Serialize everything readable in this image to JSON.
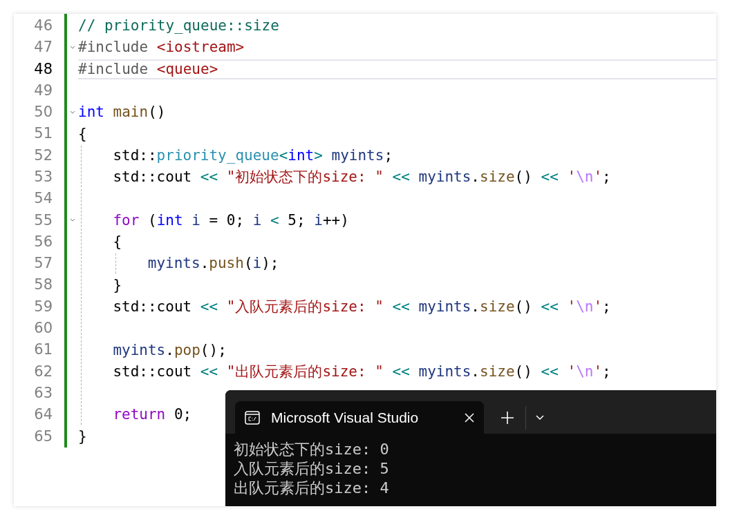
{
  "editor": {
    "lines": [
      {
        "number": "46",
        "current": false,
        "fold": false,
        "segments": [
          {
            "text": "// priority_queue::size",
            "color": "#0e6a5a"
          }
        ]
      },
      {
        "number": "47",
        "current": false,
        "fold": true,
        "segments": [
          {
            "text": "#include ",
            "color": "#5b5b5b"
          },
          {
            "text": "<iostream>",
            "color": "#a31515"
          }
        ]
      },
      {
        "number": "48",
        "current": true,
        "fold": false,
        "segments": [
          {
            "text": "#include ",
            "color": "#5b5b5b"
          },
          {
            "text": "<queue>",
            "color": "#a31515"
          }
        ]
      },
      {
        "number": "49",
        "current": false,
        "fold": false
      },
      {
        "number": "50",
        "current": false,
        "fold": true,
        "segments": [
          {
            "text": "int",
            "color": "#0000ff"
          },
          {
            "text": " main",
            "color": "#74531f"
          },
          {
            "text": "()",
            "color": "#000000"
          }
        ]
      },
      {
        "number": "51",
        "current": false,
        "fold": false,
        "segments": [
          {
            "text": "{",
            "color": "#000000"
          }
        ],
        "children": [
          {
            "number": "52",
            "current": false,
            "fold": false,
            "segments": [
              {
                "text": "std::",
                "color": "#000000"
              },
              {
                "text": "priority_queue",
                "color": "#2b91af"
              },
              {
                "text": "<",
                "color": "#008080"
              },
              {
                "text": "int",
                "color": "#0000ff"
              },
              {
                "text": "> ",
                "color": "#008080"
              },
              {
                "text": "myints",
                "color": "#1f377f"
              },
              {
                "text": ";",
                "color": "#000000"
              }
            ]
          },
          {
            "number": "53",
            "current": false,
            "fold": false,
            "segments": [
              {
                "text": "std::cout ",
                "color": "#000000"
              },
              {
                "text": "<< ",
                "color": "#008080"
              },
              {
                "text": "\"初始状态下的size: \"",
                "color": "#a31515"
              },
              {
                "text": " << ",
                "color": "#008080"
              },
              {
                "text": "myints",
                "color": "#1f377f"
              },
              {
                "text": ".",
                "color": "#000000"
              },
              {
                "text": "size",
                "color": "#74531f"
              },
              {
                "text": "() ",
                "color": "#000000"
              },
              {
                "text": "<< ",
                "color": "#008080"
              },
              {
                "text": "'",
                "color": "#a31515"
              },
              {
                "text": "\\n",
                "color": "#b776fb"
              },
              {
                "text": "'",
                "color": "#a31515"
              },
              {
                "text": ";",
                "color": "#000000"
              }
            ]
          },
          {
            "number": "54",
            "current": false,
            "fold": false
          },
          {
            "number": "55",
            "current": false,
            "fold": true,
            "segments": [
              {
                "text": "for",
                "color": "#8f08c4"
              },
              {
                "text": " (",
                "color": "#000000"
              },
              {
                "text": "int",
                "color": "#0000ff"
              },
              {
                "text": " i",
                "color": "#1f377f"
              },
              {
                "text": " = 0; ",
                "color": "#000000"
              },
              {
                "text": "i",
                "color": "#1f377f"
              },
              {
                "text": " < ",
                "color": "#008080"
              },
              {
                "text": "5; ",
                "color": "#000000"
              },
              {
                "text": "i",
                "color": "#1f377f"
              },
              {
                "text": "++)",
                "color": "#000000"
              }
            ]
          },
          {
            "number": "56",
            "current": false,
            "fold": false,
            "segments": [
              {
                "text": "{",
                "color": "#000000"
              }
            ],
            "children": [
              {
                "number": "57",
                "current": false,
                "fold": false,
                "segments": [
                  {
                    "text": "myints",
                    "color": "#1f377f"
                  },
                  {
                    "text": ".",
                    "color": "#000000"
                  },
                  {
                    "text": "push",
                    "color": "#74531f"
                  },
                  {
                    "text": "(",
                    "color": "#000000"
                  },
                  {
                    "text": "i",
                    "color": "#1f377f"
                  },
                  {
                    "text": ");",
                    "color": "#000000"
                  }
                ]
              }
            ]
          },
          {
            "number": "58",
            "current": false,
            "fold": false,
            "segments": [
              {
                "text": "}",
                "color": "#000000"
              }
            ]
          },
          {
            "number": "59",
            "current": false,
            "fold": false,
            "segments": [
              {
                "text": "std::cout ",
                "color": "#000000"
              },
              {
                "text": "<< ",
                "color": "#008080"
              },
              {
                "text": "\"入队元素后的size: \"",
                "color": "#a31515"
              },
              {
                "text": " << ",
                "color": "#008080"
              },
              {
                "text": "myints",
                "color": "#1f377f"
              },
              {
                "text": ".",
                "color": "#000000"
              },
              {
                "text": "size",
                "color": "#74531f"
              },
              {
                "text": "() ",
                "color": "#000000"
              },
              {
                "text": "<< ",
                "color": "#008080"
              },
              {
                "text": "'",
                "color": "#a31515"
              },
              {
                "text": "\\n",
                "color": "#b776fb"
              },
              {
                "text": "'",
                "color": "#a31515"
              },
              {
                "text": ";",
                "color": "#000000"
              }
            ]
          },
          {
            "number": "60",
            "current": false,
            "fold": false
          },
          {
            "number": "61",
            "current": false,
            "fold": false,
            "segments": [
              {
                "text": "myints",
                "color": "#1f377f"
              },
              {
                "text": ".",
                "color": "#000000"
              },
              {
                "text": "pop",
                "color": "#74531f"
              },
              {
                "text": "();",
                "color": "#000000"
              }
            ]
          },
          {
            "number": "62",
            "current": false,
            "fold": false,
            "segments": [
              {
                "text": "std::cout ",
                "color": "#000000"
              },
              {
                "text": "<< ",
                "color": "#008080"
              },
              {
                "text": "\"出队元素后的size: \"",
                "color": "#a31515"
              },
              {
                "text": " << ",
                "color": "#008080"
              },
              {
                "text": "myints",
                "color": "#1f377f"
              },
              {
                "text": ".",
                "color": "#000000"
              },
              {
                "text": "size",
                "color": "#74531f"
              },
              {
                "text": "() ",
                "color": "#000000"
              },
              {
                "text": "<< ",
                "color": "#008080"
              },
              {
                "text": "'",
                "color": "#a31515"
              },
              {
                "text": "\\n",
                "color": "#b776fb"
              },
              {
                "text": "'",
                "color": "#a31515"
              },
              {
                "text": ";",
                "color": "#000000"
              }
            ]
          },
          {
            "number": "63",
            "current": false,
            "fold": false
          },
          {
            "number": "64",
            "current": false,
            "fold": false,
            "segments": [
              {
                "text": "return",
                "color": "#8f08c4"
              },
              {
                "text": " 0;",
                "color": "#000000"
              }
            ]
          }
        ]
      },
      {
        "number": "65",
        "current": false,
        "fold": false,
        "segments": [
          {
            "text": "}",
            "color": "#000000"
          }
        ]
      }
    ]
  },
  "terminal": {
    "tab": {
      "title": "Microsoft Visual Studio"
    },
    "output": [
      "初始状态下的size: 0",
      "入队元素后的size: 5",
      "出队元素后的size: 4"
    ]
  }
}
